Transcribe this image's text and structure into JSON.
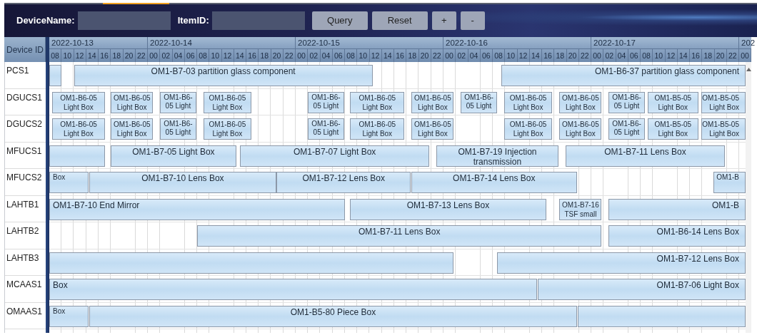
{
  "toolbar": {
    "fields": [
      {
        "label": "DeviceName:"
      },
      {
        "label": "ItemID:"
      }
    ],
    "buttons": [
      "Query",
      "Reset",
      "+",
      "-"
    ]
  },
  "gantt": {
    "device_header": "Device ID",
    "days": [
      {
        "label": "2022-10-13",
        "hours": [
          "08",
          "10",
          "12",
          "14",
          "16",
          "18",
          "20",
          "22"
        ]
      },
      {
        "label": "2022-10-14",
        "hours": [
          "00",
          "02",
          "04",
          "06",
          "08",
          "10",
          "12",
          "14",
          "16",
          "18",
          "20",
          "22"
        ]
      },
      {
        "label": "2022-10-15",
        "hours": [
          "00",
          "02",
          "04",
          "06",
          "08",
          "10",
          "12",
          "14",
          "16",
          "18",
          "20",
          "22"
        ]
      },
      {
        "label": "2022-10-16",
        "hours": [
          "00",
          "02",
          "04",
          "06",
          "08",
          "10",
          "12",
          "14",
          "16",
          "18",
          "20",
          "22"
        ]
      },
      {
        "label": "2022-10-17",
        "hours": [
          "00",
          "02",
          "04",
          "06",
          "08",
          "10",
          "12",
          "14",
          "16",
          "18",
          "20",
          "22"
        ]
      },
      {
        "label": "202",
        "hours": [
          "00"
        ]
      }
    ],
    "rows": [
      {
        "device": "PCS1",
        "tasks": [
          {
            "kind": "task"
          },
          {
            "kind": "task",
            "label": "OM1-B7-03 partition glass component"
          },
          {
            "kind": "task",
            "label": "OM1-B6-37 partition glass component"
          }
        ]
      },
      {
        "device": "DGUCS1",
        "tasks": [
          {
            "kind": "task",
            "label": "OM1-B6-05 Light Box"
          },
          {
            "kind": "task",
            "label": "OM1-B6-05 Light Box"
          },
          {
            "kind": "task",
            "label": "OM1-B6-05 Light"
          },
          {
            "kind": "task",
            "label": "OM1-B6-05 Light Box"
          },
          {
            "kind": "task",
            "label": "OM1-B6-05 Light"
          },
          {
            "kind": "task",
            "label": "OM1-B6-05 Light Box"
          },
          {
            "kind": "task",
            "label": "OM1-B6-05 Light Box"
          },
          {
            "kind": "task",
            "label": "OM1-B6-05 Light"
          },
          {
            "kind": "task",
            "label": "OM1-B6-05 Light Box"
          },
          {
            "kind": "task",
            "label": "OM1-B6-05 Light Box"
          },
          {
            "kind": "task",
            "label": "OM1-B6-05 Light"
          },
          {
            "kind": "task",
            "label": "OM1-B5-05 Light Box"
          },
          {
            "kind": "task",
            "label": "OM1-B5-05 Light Box"
          }
        ]
      },
      {
        "device": "DGUCS2",
        "tasks": [
          {
            "kind": "task",
            "label": "OM1-B6-05 Light Box"
          },
          {
            "kind": "task",
            "label": "OM1-B6-05 Light Box"
          },
          {
            "kind": "task",
            "label": "OM1-B6-05 Light"
          },
          {
            "kind": "task",
            "label": "OM1-B6-05 Light Box"
          },
          {
            "kind": "task",
            "label": "OM1-B6-05 Light"
          },
          {
            "kind": "task",
            "label": "OM1-B6-05 Light Box"
          },
          {
            "kind": "task",
            "label": "OM1-B6-05 Light Box"
          },
          {
            "kind": "task",
            "label": "OM1-B6-05 Light Box"
          },
          {
            "kind": "task",
            "label": "OM1-B6-05 Light Box"
          },
          {
            "kind": "task",
            "label": "OM1-B6-05 Light"
          },
          {
            "kind": "task",
            "label": "OM1-B5-05 Light Box"
          },
          {
            "kind": "task",
            "label": "OM1-B5-05 Light Box"
          }
        ]
      },
      {
        "device": "MFUCS1",
        "tasks": [
          {
            "kind": "task"
          },
          {
            "kind": "task",
            "label": "OM1-B7-05 Light Box"
          },
          {
            "kind": "task",
            "label": "OM1-B7-07 Light Box"
          },
          {
            "kind": "task",
            "label": "OM1-B7-19 Injection transmission"
          },
          {
            "kind": "task",
            "label": "OM1-B7-11 Lens Box"
          }
        ]
      },
      {
        "device": "MFUCS2",
        "tasks": [
          {
            "kind": "task",
            "label": "Box"
          },
          {
            "kind": "task",
            "label": "OM1-B7-10 Lens Box"
          },
          {
            "kind": "task",
            "label": "OM1-B7-12 Lens Box"
          },
          {
            "kind": "task",
            "label": "OM1-B7-14 Lens Box"
          },
          {
            "kind": "task",
            "label": "OM1-B"
          }
        ]
      },
      {
        "device": "LAHTB1",
        "tasks": [
          {
            "kind": "task",
            "label": "OM1-B7-10 End Mirror"
          },
          {
            "kind": "task",
            "label": "OM1-B7-13 Lens Box"
          },
          {
            "kind": "task",
            "label": "OM1-B7-16 TSF small"
          },
          {
            "kind": "task",
            "label": "OM1-B"
          }
        ]
      },
      {
        "device": "LAHTB2",
        "tasks": [
          {
            "kind": "task",
            "label": "OM1-B7-11 Lens Box"
          },
          {
            "kind": "task",
            "label": "OM1-B6-14 Lens Box"
          }
        ]
      },
      {
        "device": "LAHTB3",
        "tasks": [
          {
            "kind": "task"
          },
          {
            "kind": "task",
            "label": "OM1-B7-12 Lens Box"
          }
        ]
      },
      {
        "device": "MCAAS1",
        "tasks": [
          {
            "kind": "task",
            "label": "Box"
          },
          {
            "kind": "task",
            "label": "OM1-B7-06 Light Box"
          }
        ]
      },
      {
        "device": "OMAAS1",
        "tasks": [
          {
            "kind": "task",
            "label": "Box"
          },
          {
            "kind": "task",
            "label": "OM1-B5-80 Piece Box"
          },
          {
            "kind": "task"
          }
        ]
      }
    ]
  }
}
